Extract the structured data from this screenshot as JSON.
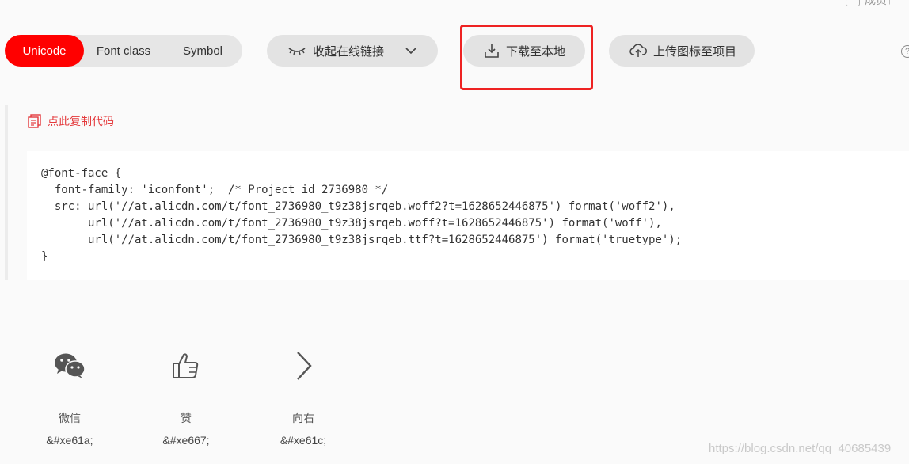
{
  "header": {
    "user_text": "成员↑"
  },
  "tabs": [
    {
      "label": "Unicode",
      "active": true
    },
    {
      "label": "Font class",
      "active": false
    },
    {
      "label": "Symbol",
      "active": false
    }
  ],
  "actions": {
    "collapse_label": "收起在线链接",
    "download_label": "下载至本地",
    "upload_label": "上传图标至项目"
  },
  "copy_label": "点此复制代码",
  "code_lines": [
    "@font-face {",
    "  font-family: 'iconfont';  /* Project id 2736980 */",
    "  src: url('//at.alicdn.com/t/font_2736980_t9z38jsrqeb.woff2?t=1628652446875') format('woff2'),",
    "       url('//at.alicdn.com/t/font_2736980_t9z38jsrqeb.woff?t=1628652446875') format('woff'),",
    "       url('//at.alicdn.com/t/font_2736980_t9z38jsrqeb.ttf?t=1628652446875') format('truetype');",
    "}"
  ],
  "icons": [
    {
      "icon": "wechat-icon",
      "name": "微信",
      "code": "&#xe61a;"
    },
    {
      "icon": "thumbs-up-icon",
      "name": "赞",
      "code": "&#xe667;"
    },
    {
      "icon": "chevron-right-icon",
      "name": "向右",
      "code": "&#xe61c;"
    }
  ],
  "watermark": "https://blog.csdn.net/qq_40685439",
  "colors": {
    "accent": "#ff0000",
    "highlight": "#ee2222",
    "link": "#e4393c"
  }
}
